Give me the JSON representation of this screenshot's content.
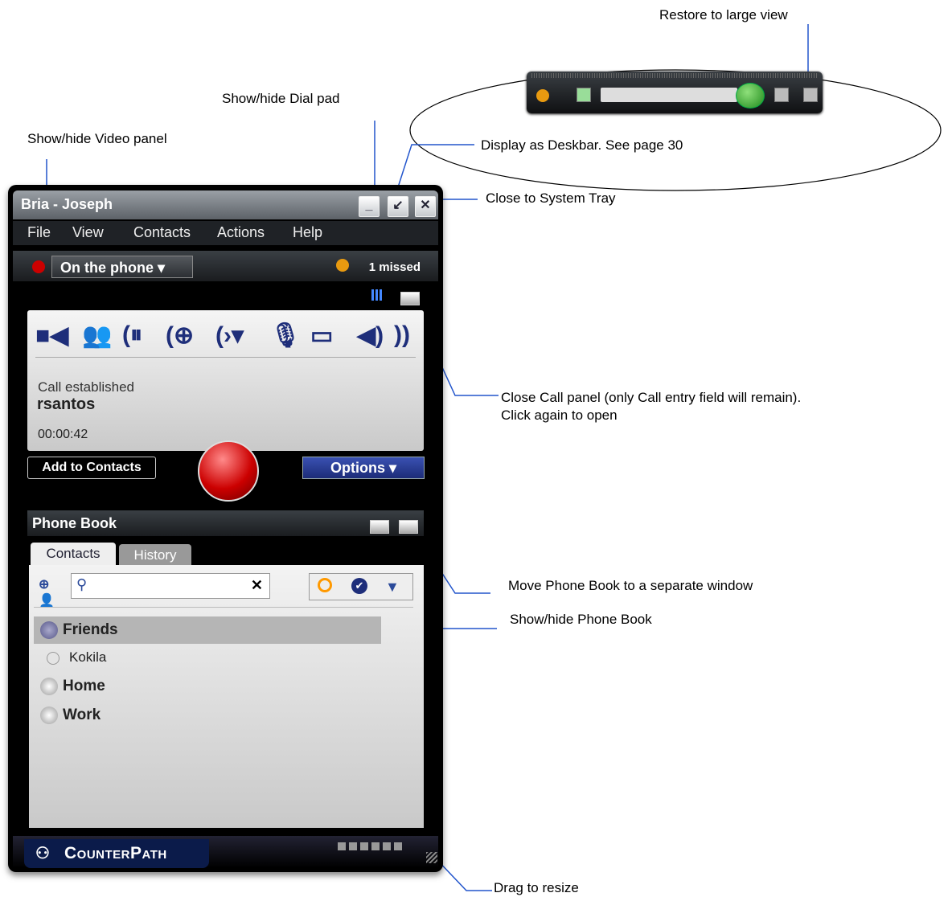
{
  "callouts": {
    "restore": "Restore to large view",
    "dialpad": "Show/hide Dial pad",
    "video": "Show/hide Video panel",
    "deskbar": "Display as Deskbar. See page 30",
    "close_tray": "Close to System Tray",
    "close_call": "Close Call panel (only Call entry field will remain). Click again to open",
    "move_pb": "Move Phone Book to a separate window",
    "showhide_pb": "Show/hide Phone Book",
    "drag": "Drag to resize"
  },
  "window": {
    "title": "Bria - Joseph"
  },
  "menu": [
    "File",
    "View",
    "Contacts",
    "Actions",
    "Help"
  ],
  "status": {
    "presence": "On the phone",
    "missed": "1 missed"
  },
  "call": {
    "state": "Call established",
    "name": "rsantos",
    "timer": "00:00:42"
  },
  "buttons": {
    "add_contacts": "Add to Contacts",
    "options": "Options"
  },
  "phonebook": {
    "title": "Phone Book",
    "tabs": [
      "Contacts",
      "History"
    ],
    "groups": [
      {
        "name": "Friends"
      },
      {
        "name": "Home"
      },
      {
        "name": "Work"
      }
    ],
    "contact": "Kokila"
  },
  "brand": "CounterPath",
  "colors": {
    "accent": "#1e2e7a",
    "hangup": "#cc0000",
    "call_green": "#1f8b1c"
  }
}
